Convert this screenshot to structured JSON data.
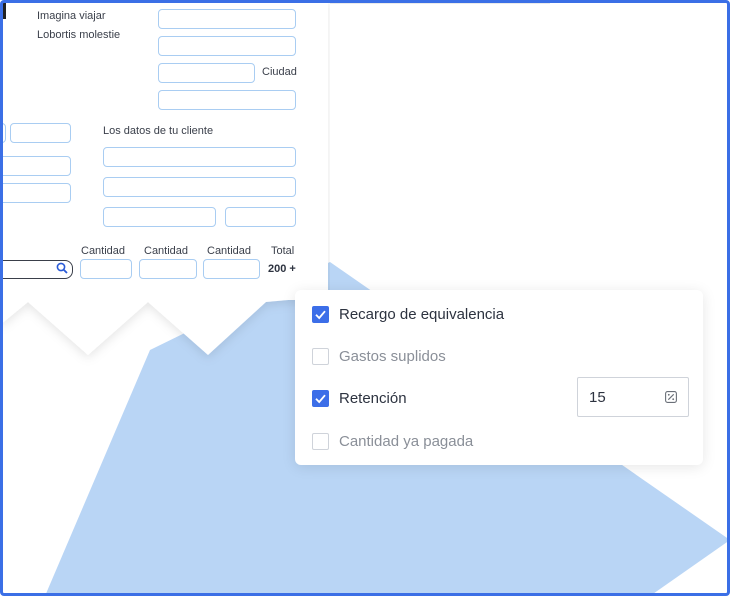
{
  "invoice": {
    "sender_lines": [
      "Imagina viajar",
      "Lobortis molestie"
    ],
    "city_label": "Ciudad",
    "client_title": "Los datos de tu cliente",
    "columns": [
      "Cantidad",
      "Cantidad",
      "Cantidad"
    ],
    "total_label": "Total",
    "total_value": "200 +"
  },
  "options_panel": {
    "options": [
      {
        "label": "Recargo de equivalencia",
        "checked": true
      },
      {
        "label": "Gastos suplidos",
        "checked": false
      },
      {
        "label": "Retención",
        "checked": true
      },
      {
        "label": "Cantidad ya pagada",
        "checked": false
      }
    ],
    "retention_value": "15",
    "retention_icon": "percent-icon"
  },
  "colors": {
    "accent": "#3c6ee8",
    "frame_border": "#3b6fe6",
    "field_border": "#a9cdf2",
    "background_shape": "#b9d5f5"
  }
}
